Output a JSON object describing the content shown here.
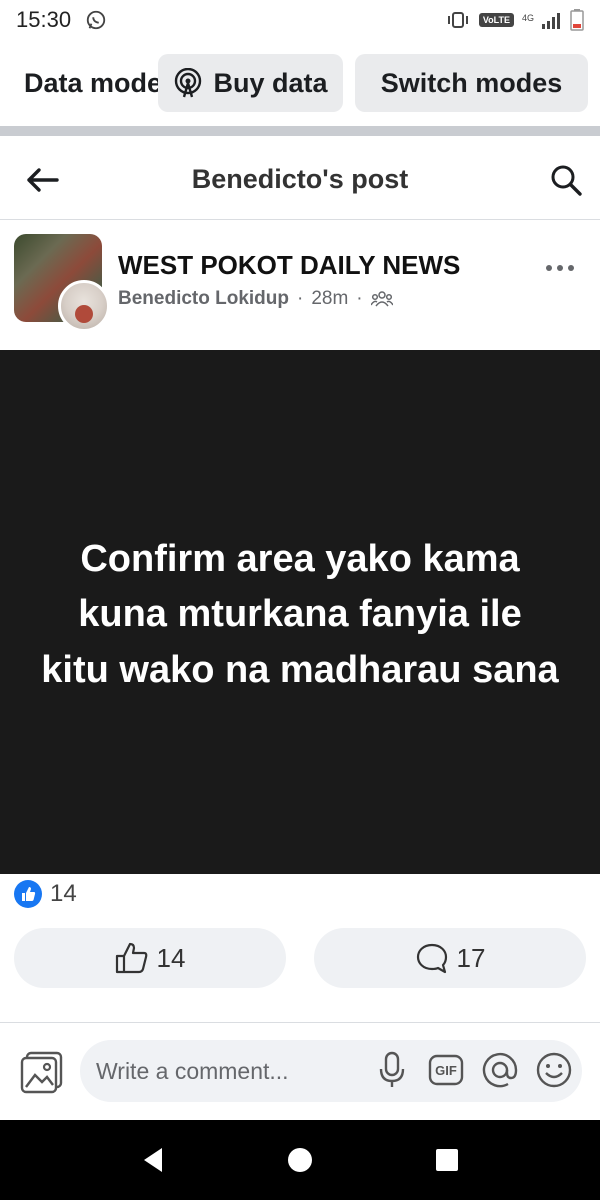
{
  "status_bar": {
    "time": "15:30",
    "volte": "VoLTE",
    "network": "4G",
    "icons": [
      "whatsapp-icon",
      "vibrate-icon",
      "signal-icon",
      "battery-low-icon"
    ]
  },
  "data_mode_bar": {
    "label": "Data mode",
    "buy_data_label": "Buy data",
    "switch_modes_label": "Switch modes"
  },
  "header": {
    "title": "Benedicto's post"
  },
  "post": {
    "group_name": "WEST POKOT DAILY NEWS",
    "author": "Benedicto Lokidup",
    "time": "28m",
    "separator": "·",
    "body_text": "Confirm area yako kama kuna mturkana fanyia ile kitu wako na madharau sana"
  },
  "reactions": {
    "count": "14"
  },
  "actions": {
    "like_count": "14",
    "comment_count": "17"
  },
  "comment_bar": {
    "placeholder": "Write a comment...",
    "gif_label": "GIF"
  },
  "colors": {
    "accent": "#1877f2",
    "post_background": "#1a1a1a",
    "chip_background": "#eaebed"
  }
}
